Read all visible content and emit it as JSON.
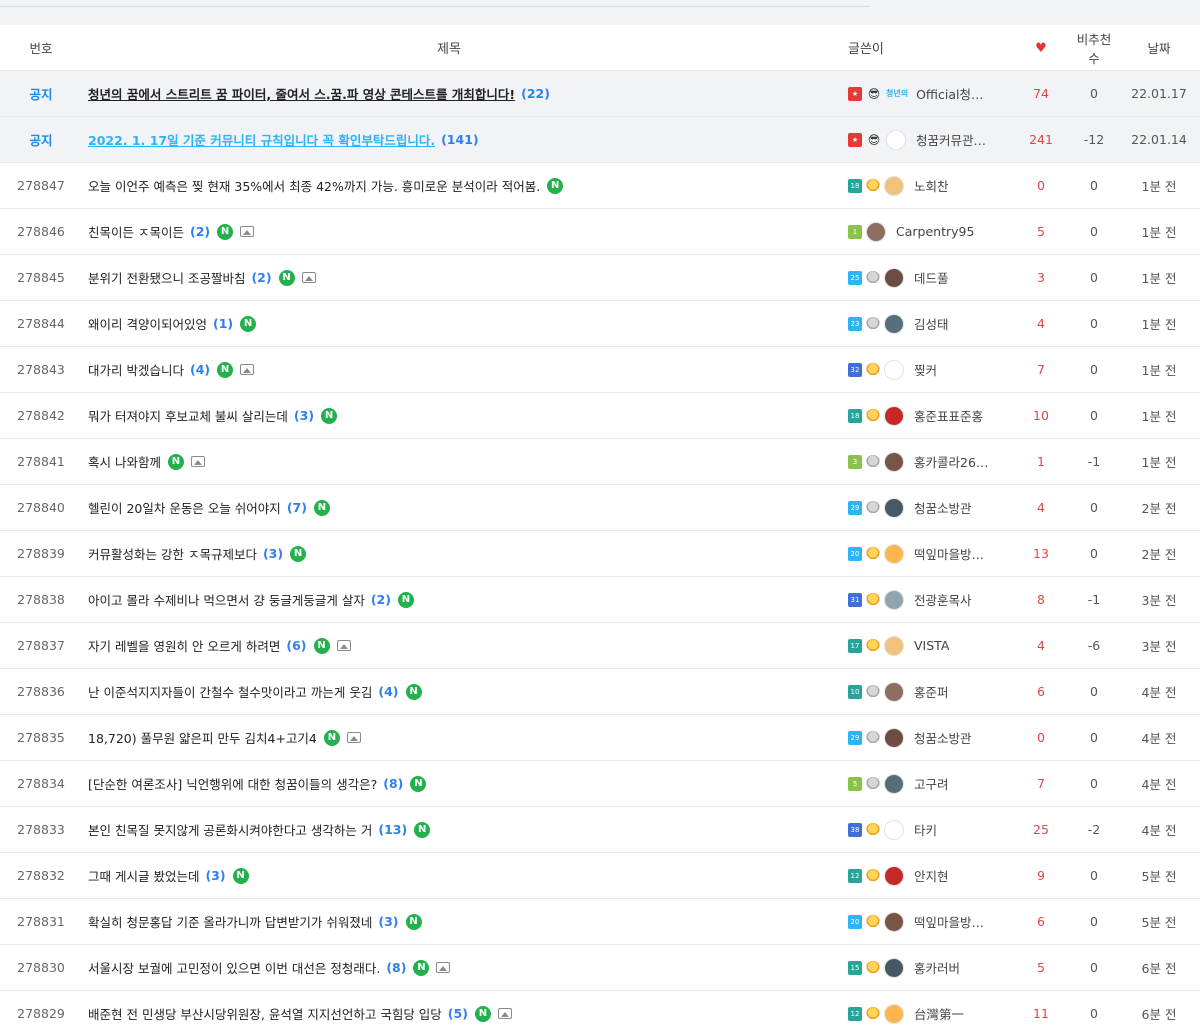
{
  "header": {
    "num": "번호",
    "title": "제목",
    "author": "글쓴이",
    "likes_icon": "heart-icon",
    "rec": "비추천 수",
    "date": "날짜"
  },
  "notices": [
    {
      "label": "공지",
      "title": "청년의 꿈에서 스트리트 꿈 파이터, 줄여서 스.꿈.파 영상 콘테스트를 개최합니다!",
      "comments": "(22)",
      "author": "Official청…",
      "logo_text": "청년의",
      "likes": "74",
      "rec": "0",
      "date": "22.01.17"
    },
    {
      "label": "공지",
      "title": "2022. 1. 17일 기준 커뮤니티 규칙입니다 꼭 확인부탁드립니다.",
      "comments": "(141)",
      "author": "청꿈커뮤관…",
      "likes": "241",
      "rec": "-12",
      "date": "22.01.14"
    }
  ],
  "posts": [
    {
      "num": "278847",
      "title": "오늘 이언주 예측은 찢 현재 35%에서 최종 42%까지 가능. 흥미로운 분석이라 적어봄.",
      "comments": "",
      "new": true,
      "image": false,
      "level": "18",
      "medal": "gold",
      "author": "노회찬",
      "likes": "0",
      "rec": "0",
      "date": "1분 전"
    },
    {
      "num": "278846",
      "title": "친목이든 ㅈ목이든",
      "comments": "(2)",
      "new": true,
      "image": true,
      "level": "1",
      "medal": "",
      "author": "Carpentry95",
      "likes": "5",
      "rec": "0",
      "date": "1분 전"
    },
    {
      "num": "278845",
      "title": "분위기 전환됐으니 조공짤바침",
      "comments": "(2)",
      "new": true,
      "image": true,
      "level": "25",
      "medal": "gray",
      "author": "데드풀",
      "likes": "3",
      "rec": "0",
      "date": "1분 전"
    },
    {
      "num": "278844",
      "title": "왜이리 격양이되어있엉",
      "comments": "(1)",
      "new": true,
      "image": false,
      "level": "23",
      "medal": "gray",
      "author": "김성태",
      "likes": "4",
      "rec": "0",
      "date": "1분 전"
    },
    {
      "num": "278843",
      "title": "대가리 박겠습니다",
      "comments": "(4)",
      "new": true,
      "image": true,
      "level": "32",
      "medal": "gold",
      "author": "찢커",
      "likes": "7",
      "rec": "0",
      "date": "1분 전"
    },
    {
      "num": "278842",
      "title": "뭐가 터져야지 후보교체 불씨 살리는데",
      "comments": "(3)",
      "new": true,
      "image": false,
      "level": "18",
      "medal": "gold",
      "author": "홍준표표준홍",
      "likes": "10",
      "rec": "0",
      "date": "1분 전"
    },
    {
      "num": "278841",
      "title": "혹시 나와함께",
      "comments": "",
      "new": true,
      "image": true,
      "level": "3",
      "medal": "gray",
      "author": "홍카콜라26…",
      "likes": "1",
      "rec": "-1",
      "date": "1분 전"
    },
    {
      "num": "278840",
      "title": "헬린이 20일차 운동은 오늘 쉬어야지",
      "comments": "(7)",
      "new": true,
      "image": false,
      "level": "29",
      "medal": "gray",
      "author": "청꿈소방관",
      "likes": "4",
      "rec": "0",
      "date": "2분 전"
    },
    {
      "num": "278839",
      "title": "커뮤활성화는 강한 ㅈ목규제보다",
      "comments": "(3)",
      "new": true,
      "image": false,
      "level": "20",
      "medal": "gold",
      "author": "떡잎마을방…",
      "likes": "13",
      "rec": "0",
      "date": "2분 전"
    },
    {
      "num": "278838",
      "title": "아이고 몰라 수제비나 먹으면서 걍 둥글게둥글게 살자",
      "comments": "(2)",
      "new": true,
      "image": false,
      "level": "31",
      "medal": "gold",
      "author": "전광훈목사",
      "likes": "8",
      "rec": "-1",
      "date": "3분 전"
    },
    {
      "num": "278837",
      "title": "자기 레벨을 영원히 안 오르게 하려면",
      "comments": "(6)",
      "new": true,
      "image": true,
      "level": "17",
      "medal": "gold",
      "author": "VISTA",
      "likes": "4",
      "rec": "-6",
      "date": "3분 전"
    },
    {
      "num": "278836",
      "title": "난 이준석지지자들이 간철수 철수맛이라고 까는게 웃김",
      "comments": "(4)",
      "new": true,
      "image": false,
      "level": "10",
      "medal": "gray",
      "author": "홍준퍼",
      "likes": "6",
      "rec": "0",
      "date": "4분 전"
    },
    {
      "num": "278835",
      "title": "18,720) 풀무원 얇은피 만두 김치4+고기4",
      "comments": "",
      "new": true,
      "image": true,
      "level": "29",
      "medal": "gray",
      "author": "청꿈소방관",
      "likes": "0",
      "rec": "0",
      "date": "4분 전"
    },
    {
      "num": "278834",
      "title": "[단순한 여론조사] 닉언행위에 대한 청꿈이들의 생각은?",
      "comments": "(8)",
      "new": true,
      "image": false,
      "level": "5",
      "medal": "gray",
      "author": "고구려",
      "likes": "7",
      "rec": "0",
      "date": "4분 전"
    },
    {
      "num": "278833",
      "title": "본인 친목질 못지않게 공론화시켜야한다고 생각하는 거",
      "comments": "(13)",
      "new": true,
      "image": false,
      "level": "38",
      "medal": "gold",
      "author": "타키",
      "likes": "25",
      "rec": "-2",
      "date": "4분 전"
    },
    {
      "num": "278832",
      "title": "그때 게시글 봤었는데",
      "comments": "(3)",
      "new": true,
      "image": false,
      "level": "12",
      "medal": "gold",
      "author": "안지현",
      "likes": "9",
      "rec": "0",
      "date": "5분 전"
    },
    {
      "num": "278831",
      "title": "확실히 청문홍답 기준 올라가니까 답변받기가 쉬워졌네",
      "comments": "(3)",
      "new": true,
      "image": false,
      "level": "20",
      "medal": "gold",
      "author": "떡잎마을방…",
      "likes": "6",
      "rec": "0",
      "date": "5분 전"
    },
    {
      "num": "278830",
      "title": "서울시장 보궐에 고민정이 있으면 이번 대선은 정청래다.",
      "comments": "(8)",
      "new": true,
      "image": true,
      "level": "15",
      "medal": "gold",
      "author": "홍카러버",
      "likes": "5",
      "rec": "0",
      "date": "6분 전"
    },
    {
      "num": "278829",
      "title": "배준현 전 민생당 부산시당위원장, 윤석열 지지선언하고 국힘당 입당",
      "comments": "(5)",
      "new": true,
      "image": true,
      "level": "12",
      "medal": "gold",
      "author": "台灣第一",
      "likes": "11",
      "rec": "0",
      "date": "6분 전"
    }
  ],
  "icons": {
    "new_badge": "N",
    "image": "image-icon",
    "admin_badge": "★",
    "emoji": "😎"
  },
  "colors": {
    "accent": "#1e88e5",
    "comment_count": "#2f80ed",
    "likes": "#e04848",
    "new_badge": "#22b14c",
    "notice_link": "#29b6f6"
  }
}
